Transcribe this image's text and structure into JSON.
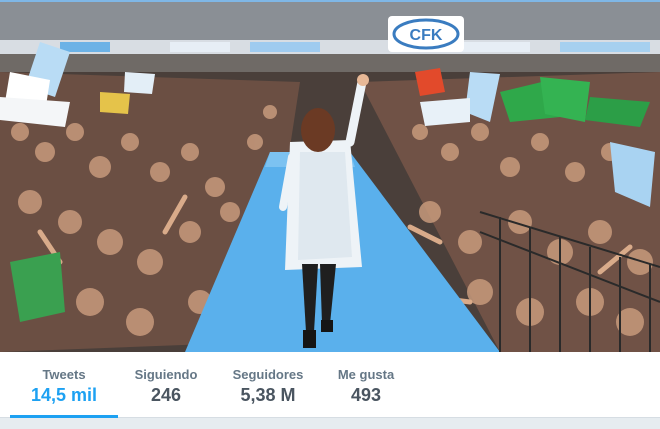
{
  "banner": {
    "stadium_sign": "CFK"
  },
  "stats": [
    {
      "label": "Tweets",
      "value": "14,5 mil",
      "active": true
    },
    {
      "label": "Siguiendo",
      "value": "246",
      "active": false
    },
    {
      "label": "Seguidores",
      "value": "5,38 M",
      "active": false
    },
    {
      "label": "Me gusta",
      "value": "493",
      "active": false
    }
  ],
  "colors": {
    "accent": "#1da1f2",
    "label": "#657786",
    "value": "#4a5560",
    "stage": "#5ab0ec",
    "flag_blue": "#b9dcf5",
    "flag_green": "#2fa84a"
  }
}
